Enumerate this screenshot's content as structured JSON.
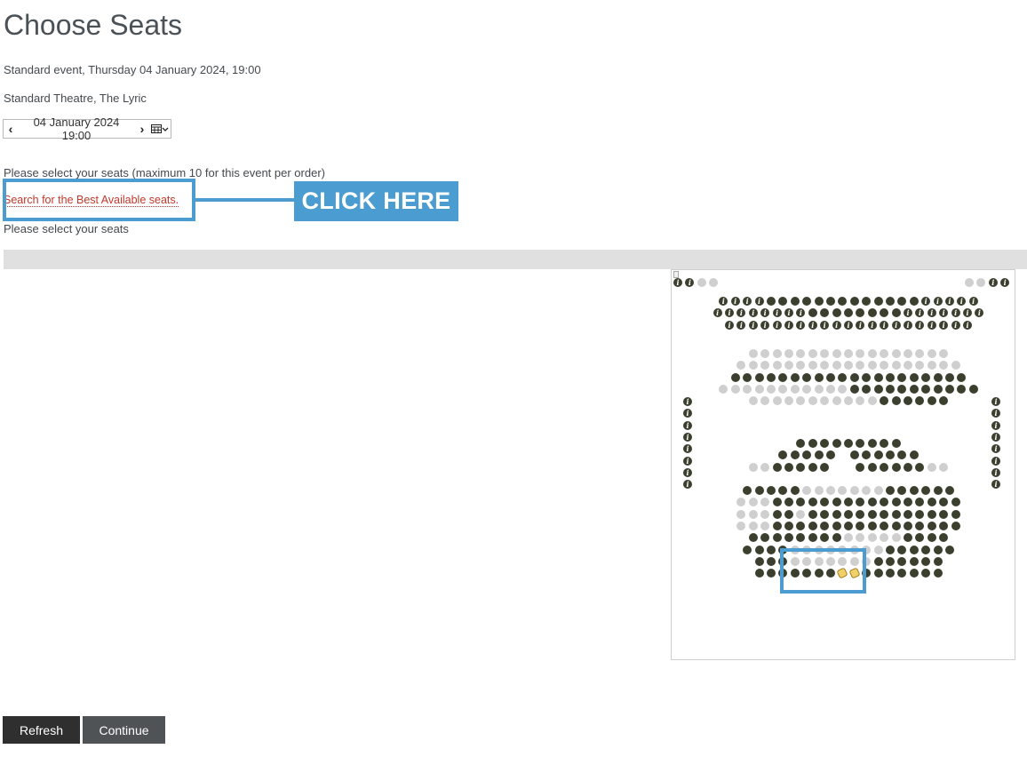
{
  "page": {
    "title": "Choose Seats",
    "event_line": "Standard event, Thursday 04 January 2024, 19:00",
    "venue_line": "Standard Theatre, The Lyric"
  },
  "date_picker": {
    "value": "04 January 2024 19:00",
    "prev_icon": "chevron-left-icon",
    "next_icon": "chevron-right-icon",
    "calendar_icon": "calendar-dropdown-icon"
  },
  "selection": {
    "instructions": "Please select your seats (maximum 10 for this event per order)",
    "best_available_link": "Search for the Best Available seats.",
    "prompt": "Please select your seats"
  },
  "annotation": {
    "click_here": "CLICK HERE",
    "color": "#4a9cd1"
  },
  "seatmap": {
    "colors": {
      "available": "#3b3f2e",
      "unavailable": "#cfcfcf",
      "selected": "#f1cf6a"
    },
    "legend": "A = available, U = unavailable, i = info, S = selected",
    "blocks": [
      {
        "rows": [
          "iiUU"
        ]
      },
      {
        "rows": [
          "UUii"
        ]
      },
      {
        "rows": [
          "iiiiAAAAAAAAAAAAAiiiii",
          "iiiiiiiiAAAAAAAAiiiiiii",
          "iiiiiiiiiiiiiiiiiiiii"
        ]
      },
      {
        "rows": [
          "UUUUUUUUUUUUUUUUU",
          "UUUUUUUUUUUUUUUUUUU",
          "AAAAAAAAAAAAAAAAAAAA",
          "UUUUUUUUUUUAAAAAAAAAAA",
          "UUUUUUUUUUUAAAAAA"
        ]
      },
      {
        "rows": [
          "i",
          "i",
          "i",
          "i",
          "i",
          "i",
          "i",
          "i"
        ]
      },
      {
        "rows": [
          "i",
          "i",
          "i",
          "i",
          "i",
          "i",
          "i",
          "i"
        ]
      },
      {
        "rows": [
          "AAAAAAAAA",
          "AAAAA-AAAAAA",
          "UUAAAAA--AAAAAAUU"
        ]
      },
      {
        "rows": [
          "AAAAAUUUUUUUAAAAAA",
          "UUUAAAAAAAAAAAAAAAA",
          "UUUAAUAAAAAAAAAAAAA",
          "UUUAAAAAAAAAAAAAAAA",
          "AAAAAAAAUUUUUAAAA",
          "AAAAUUUUUUUUAAAAAA",
          "AAAUUUUUUUAAAAAA",
          "AAAAAAASSAAAAAAA"
        ]
      }
    ]
  },
  "buttons": {
    "refresh": "Refresh",
    "continue": "Continue"
  }
}
